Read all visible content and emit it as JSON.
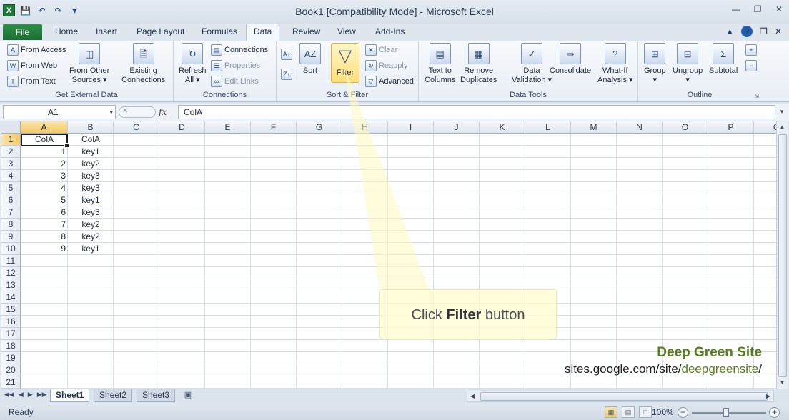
{
  "window": {
    "title": "Book1  [Compatibility Mode]  -  Microsoft Excel"
  },
  "ribbon_tabs": {
    "file": "File",
    "items": [
      "Home",
      "Insert",
      "Page Layout",
      "Formulas",
      "Data",
      "Review",
      "View",
      "Add-Ins"
    ],
    "active": "Data"
  },
  "ribbon": {
    "get_external": {
      "from_access": "From Access",
      "from_web": "From Web",
      "from_text": "From Text",
      "from_other_line1": "From Other",
      "from_other_line2": "Sources",
      "existing_line1": "Existing",
      "existing_line2": "Connections",
      "label": "Get External Data"
    },
    "connections": {
      "refresh_line1": "Refresh",
      "refresh_line2": "All",
      "connections": "Connections",
      "properties": "Properties",
      "edit_links": "Edit Links",
      "label": "Connections"
    },
    "sort_filter": {
      "sort": "Sort",
      "filter": "Filter",
      "clear": "Clear",
      "reapply": "Reapply",
      "advanced": "Advanced",
      "label": "Sort & Filter"
    },
    "data_tools": {
      "text_to_columns_line1": "Text to",
      "text_to_columns_line2": "Columns",
      "remove_dup_line1": "Remove",
      "remove_dup_line2": "Duplicates",
      "validation_line1": "Data",
      "validation_line2": "Validation",
      "consolidate": "Consolidate",
      "whatif_line1": "What-If",
      "whatif_line2": "Analysis",
      "label": "Data Tools"
    },
    "outline": {
      "group": "Group",
      "ungroup": "Ungroup",
      "subtotal": "Subtotal",
      "label": "Outline"
    }
  },
  "formula_bar": {
    "name_box": "A1",
    "fx": "fx",
    "value": "ColA"
  },
  "columns": [
    "A",
    "B",
    "C",
    "D",
    "E",
    "F",
    "G",
    "H",
    "I",
    "J",
    "K",
    "L",
    "M",
    "N",
    "O",
    "P",
    "Q"
  ],
  "rows": [
    "1",
    "2",
    "3",
    "4",
    "5",
    "6",
    "7",
    "8",
    "9",
    "10",
    "11",
    "12",
    "13",
    "14",
    "15",
    "16",
    "17",
    "18",
    "19",
    "20",
    "21"
  ],
  "cells": {
    "header": [
      "ColA",
      "ColA"
    ],
    "colA": [
      "1",
      "2",
      "3",
      "4",
      "5",
      "6",
      "7",
      "8",
      "9"
    ],
    "colB": [
      "key1",
      "key2",
      "key3",
      "key3",
      "key1",
      "key3",
      "key2",
      "key2",
      "key1"
    ]
  },
  "sheets": {
    "tabs": [
      "Sheet1",
      "Sheet2",
      "Sheet3"
    ],
    "active": "Sheet1"
  },
  "status": {
    "text": "Ready",
    "zoom": "100%"
  },
  "overlay": {
    "callout_prefix": "Click ",
    "callout_bold": "Filter",
    "callout_suffix": " button",
    "site_title": "Deep Green Site",
    "url_prefix": "sites.google.com/site/",
    "url_highlight": "deepgreensite",
    "url_suffix": "/"
  }
}
